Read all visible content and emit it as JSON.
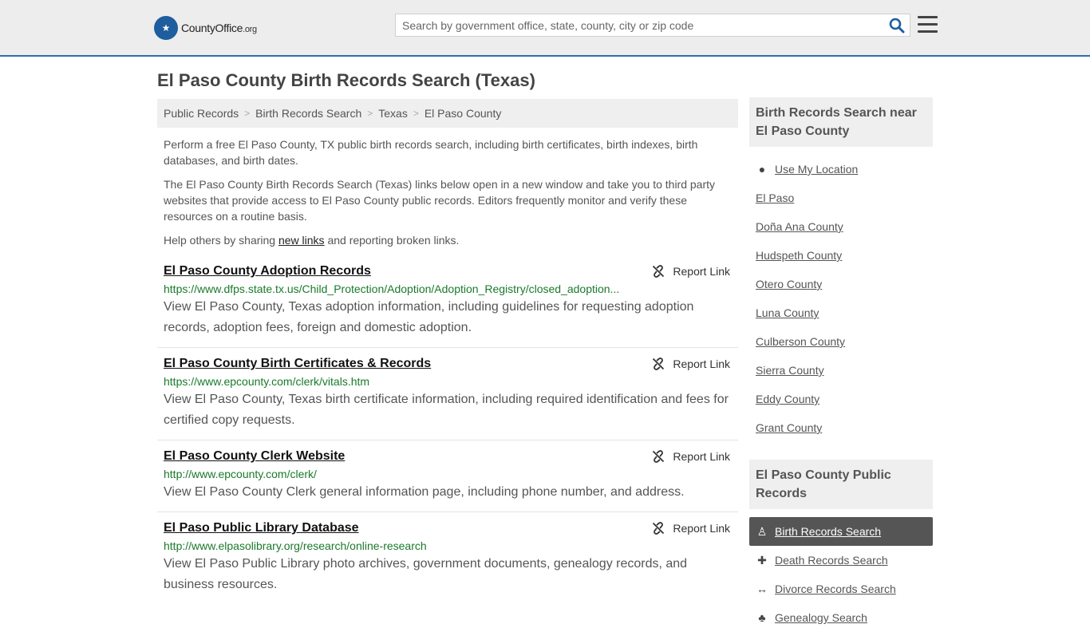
{
  "header": {
    "logo_text": "CountyOffice",
    "logo_suffix": ".org",
    "search_placeholder": "Search by government office, state, county, city or zip code"
  },
  "page_title": "El Paso County Birth Records Search (Texas)",
  "breadcrumb": [
    "Public Records",
    "Birth Records Search",
    "Texas",
    "El Paso County"
  ],
  "intro": {
    "p1": "Perform a free El Paso County, TX public birth records search, including birth certificates, birth indexes, birth databases, and birth dates.",
    "p2": "The El Paso County Birth Records Search (Texas) links below open in a new window and take you to third party websites that provide access to El Paso County public records. Editors frequently monitor and verify these resources on a routine basis.",
    "p3_before": "Help others by sharing ",
    "p3_link": "new links",
    "p3_after": " and reporting broken links."
  },
  "report_label": "Report Link",
  "results": [
    {
      "title": "El Paso County Adoption Records",
      "url": "https://www.dfps.state.tx.us/Child_Protection/Adoption/Adoption_Registry/closed_adoption...",
      "desc": "View El Paso County, Texas adoption information, including guidelines for requesting adoption records, adoption fees, foreign and domestic adoption."
    },
    {
      "title": "El Paso County Birth Certificates & Records",
      "url": "https://www.epcounty.com/clerk/vitals.htm",
      "desc": "View El Paso County, Texas birth certificate information, including required identification and fees for certified copy requests."
    },
    {
      "title": "El Paso County Clerk Website",
      "url": "http://www.epcounty.com/clerk/",
      "desc": "View El Paso County Clerk general information page, including phone number, and address."
    },
    {
      "title": "El Paso Public Library Database",
      "url": "http://www.elpasolibrary.org/research/online-research",
      "desc": "View El Paso Public Library photo archives, government documents, genealogy records, and business resources."
    }
  ],
  "sidebar": {
    "near_heading": "Birth Records Search near El Paso County",
    "near_items": [
      {
        "label": "Use My Location",
        "icon": "map-pin-icon"
      },
      {
        "label": "El Paso"
      },
      {
        "label": "Doña Ana County"
      },
      {
        "label": "Hudspeth County"
      },
      {
        "label": "Otero County"
      },
      {
        "label": "Luna County"
      },
      {
        "label": "Culberson County"
      },
      {
        "label": "Sierra County"
      },
      {
        "label": "Eddy County"
      },
      {
        "label": "Grant County"
      }
    ],
    "records_heading": "El Paso County Public Records",
    "records_items": [
      {
        "label": "Birth Records Search",
        "icon": "baby-icon",
        "active": true
      },
      {
        "label": "Death Records Search",
        "icon": "cross-icon"
      },
      {
        "label": "Divorce Records Search",
        "icon": "arrows-icon"
      },
      {
        "label": "Genealogy Search",
        "icon": "tree-icon"
      }
    ]
  },
  "colors": {
    "accent": "#2d6eb0",
    "url_green": "#1a7a2a",
    "active_bg": "#555555"
  }
}
